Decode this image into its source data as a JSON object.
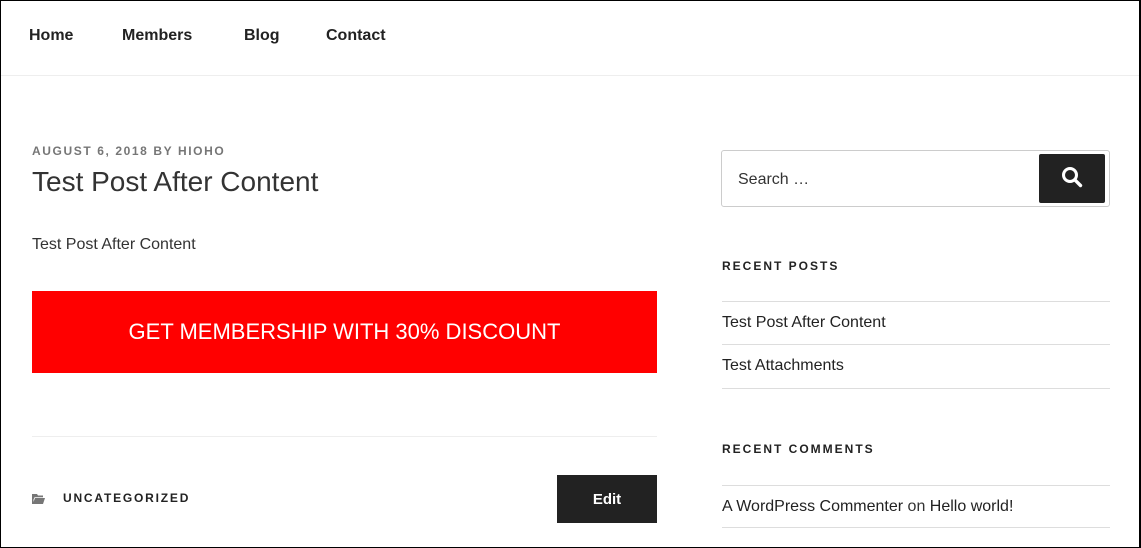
{
  "nav": {
    "items": [
      "Home",
      "Members",
      "Blog",
      "Contact"
    ]
  },
  "post": {
    "date": "AUGUST 6, 2018",
    "by": "BY",
    "author": "HIOHO",
    "title": "Test Post After Content",
    "body": "Test Post After Content",
    "cta_label": "GET MEMBERSHIP WITH 30% DISCOUNT",
    "category": "UNCATEGORIZED",
    "edit_label": "Edit"
  },
  "sidebar": {
    "search": {
      "placeholder": "Search …"
    },
    "recent_posts": {
      "title": "RECENT POSTS",
      "items": [
        "Test Post After Content",
        "Test Attachments"
      ]
    },
    "recent_comments": {
      "title": "RECENT COMMENTS",
      "items": [
        {
          "author": "A WordPress Commenter",
          "on": "on",
          "post": "Hello world!"
        }
      ]
    }
  },
  "colors": {
    "cta_background": "#ff0000",
    "button_dark": "#222222",
    "meta_gray": "#767676"
  },
  "icons": [
    "folder-icon",
    "search-icon"
  ]
}
